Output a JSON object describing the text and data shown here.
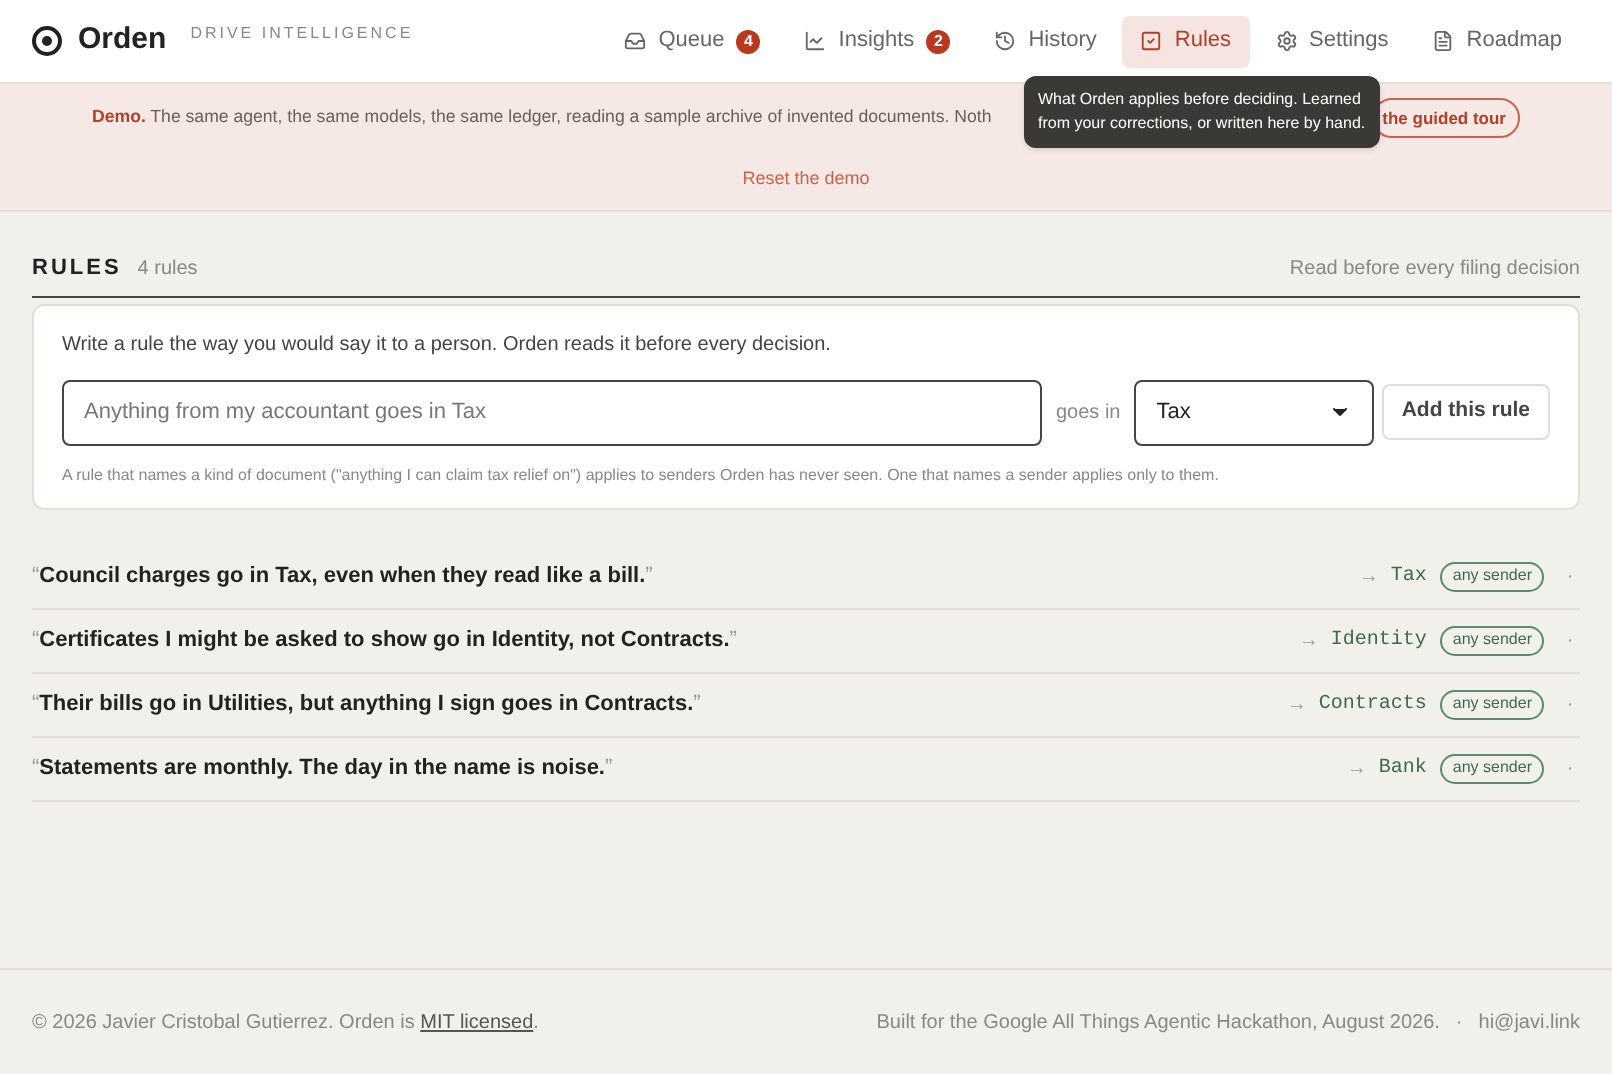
{
  "brand": {
    "name": "Orden",
    "tagline": "DRIVE INTELLIGENCE"
  },
  "nav": [
    {
      "label": "Queue",
      "badge": "4",
      "selected": false
    },
    {
      "label": "Insights",
      "badge": "2",
      "selected": false
    },
    {
      "label": "History",
      "selected": false
    },
    {
      "label": "Rules",
      "selected": true
    },
    {
      "label": "Settings",
      "selected": false
    },
    {
      "label": "Roadmap",
      "selected": false
    }
  ],
  "tooltip": "What Orden applies before deciding. Learned from your corrections, or written here by hand.",
  "banner": {
    "text": "**Demo.** The same agent, the same models, the same ledger, reading a sample archive of invented documents. Noth",
    "tour_button": "the guided tour",
    "reset_link": "Reset the demo"
  },
  "section": {
    "title": "RULES",
    "count": "4 rules",
    "note": "Read before every filing decision"
  },
  "composer": {
    "intro": "Write a rule the way you would say it to a person. Orden reads it before every decision.",
    "placeholder": "Anything from my accountant goes in Tax",
    "joiner": "goes in",
    "category": "Tax",
    "button": "Add this rule",
    "hint": "A rule that names a kind of document (\"anything I can claim tax relief on\") applies to senders Orden has never seen. One that names a sender applies only to them."
  },
  "rules": [
    {
      "open_quote": "“",
      "text": "Council charges go in Tax, even when they read like a bill.",
      "close_quote": "”",
      "arrow": "→",
      "folder": "Tax",
      "scope": "any sender",
      "action": "·"
    },
    {
      "open_quote": "“",
      "text": "Certificates I might be asked to show go in Identity, not Contracts.",
      "close_quote": "”",
      "arrow": "→",
      "folder": "Identity",
      "scope": "any sender",
      "action": "·"
    },
    {
      "open_quote": "“",
      "text": "Their bills go in Utilities, but anything I sign goes in Contracts.",
      "close_quote": "”",
      "arrow": "→",
      "folder": "Contracts",
      "scope": "any sender",
      "action": "·"
    },
    {
      "open_quote": "“",
      "text": "Statements are monthly. The day in the name is noise.",
      "close_quote": "”",
      "arrow": "→",
      "folder": "Bank",
      "scope": "any sender",
      "action": "·"
    }
  ],
  "footer": {
    "copyright": "© 2026 Javier Cristobal Gutierrez. Orden is",
    "license_link": "MIT licensed",
    "period": ".",
    "built_for": "Built for the Google All Things Agentic Hackathon, August 2026.",
    "separator": "·",
    "email": "hi@javi.link"
  }
}
